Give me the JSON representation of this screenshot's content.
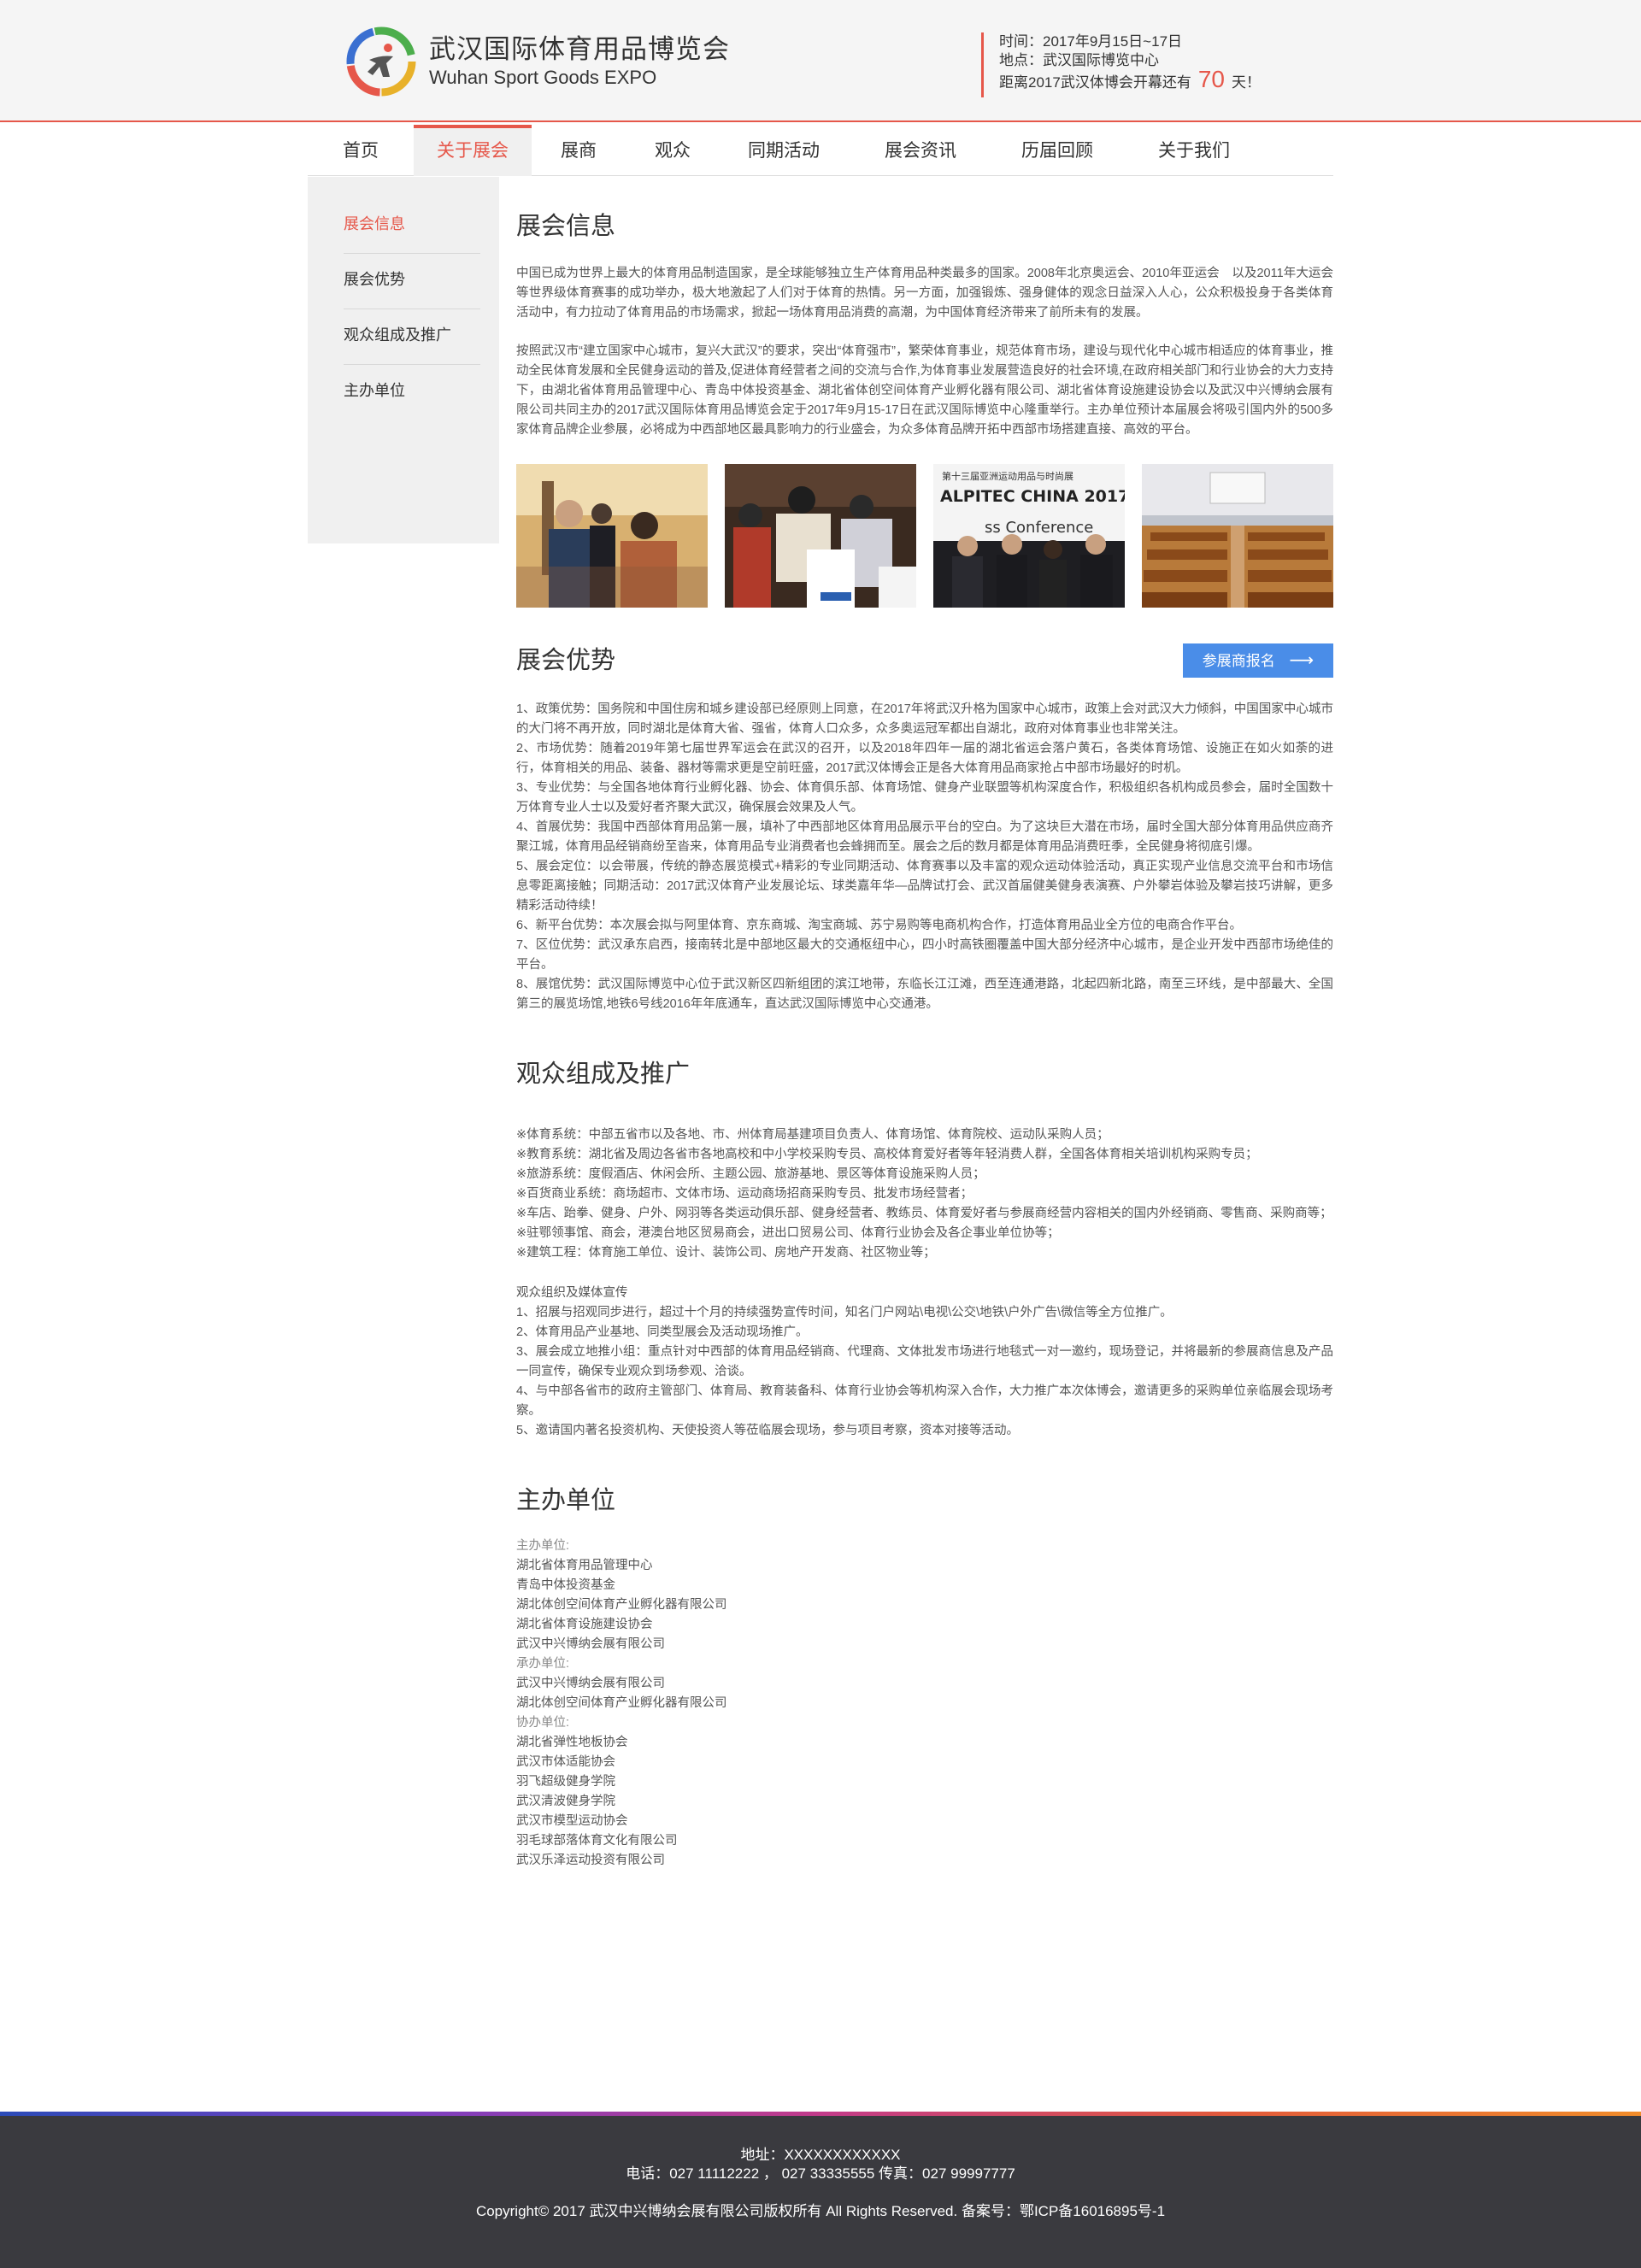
{
  "header": {
    "logo_cn": "武汉国际体育用品博览会",
    "logo_en": "Wuhan Sport Goods EXPO",
    "time_text": "时间：2017年9月15日~17日",
    "place_text": "地点：武汉国际博览中心",
    "countdown_prefix": "距离2017武汉体博会开幕还有",
    "countdown_days": "70",
    "countdown_suffix": "天！"
  },
  "nav": {
    "items": [
      {
        "label": "首页"
      },
      {
        "label": "关于展会"
      },
      {
        "label": "展商"
      },
      {
        "label": "观众"
      },
      {
        "label": "同期活动"
      },
      {
        "label": "展会资讯"
      },
      {
        "label": "历届回顾"
      },
      {
        "label": "关于我们"
      }
    ]
  },
  "sidebar": {
    "items": [
      {
        "label": "展会信息"
      },
      {
        "label": "展会优势"
      },
      {
        "label": "观众组成及推广"
      },
      {
        "label": "主办单位"
      }
    ]
  },
  "info": {
    "title": "展会信息",
    "p1": "中国已成为世界上最大的体育用品制造国家，是全球能够独立生产体育用品种类最多的国家。2008年北京奥运会、2010年亚运会　以及2011年大运会等世界级体育赛事的成功举办，极大地激起了人们对于体育的热情。另一方面，加强锻炼、强身健体的观念日益深入人心，公众积极投身于各类体育活动中，有力拉动了体育用品的市场需求，掀起一场体育用品消费的高潮，为中国体育经济带来了前所未有的发展。",
    "p2": "按照武汉市“建立国家中心城市，复兴大武汉”的要求，突出“体育强市”，繁荣体育事业，规范体育市场，建设与现代化中心城市相适应的体育事业，推动全民体育发展和全民健身运动的普及,促进体育经营者之间的交流与合作,为体育事业发展营造良好的社会环境,在政府相关部门和行业协会的大力支持下，由湖北省体育用品管理中心、青岛中体投资基金、湖北省体创空间体育产业孵化器有限公司、湖北省体育设施建设协会以及武汉中兴博纳会展有限公司共同主办的2017武汉国际体育用品博览会定于2017年9月15-17日在武汉国际博览中心隆重举行。主办单位预计本届展会将吸引国内外的500多家体育品牌企业参展，必将成为中西部地区最具影响力的行业盛会，为众多体育品牌开拓中西部市场搭建直接、高效的平台。",
    "photo3_line1": "第十三届亚洲运动用品与时尚展",
    "photo3_line2": "ALPITEC CHINA 2017",
    "photo3_line3": "ss Conference"
  },
  "advantage": {
    "title": "展会优势",
    "button_label": "参展商报名",
    "lines": [
      "1、政策优势：国务院和中国住房和城乡建设部已经原则上同意，在2017年将武汉升格为国家中心城市，政策上会对武汉大力倾斜，中国国家中心城市的大门将不再开放，同时湖北是体育大省、强省，体育人口众多，众多奥运冠军都出自湖北，政府对体育事业也非常关注。",
      "2、市场优势：随着2019年第七届世界军运会在武汉的召开，以及2018年四年一届的湖北省运会落户黄石，各类体育场馆、设施正在如火如荼的进行，体育相关的用品、装备、器材等需求更是空前旺盛，2017武汉体博会正是各大体育用品商家抢占中部市场最好的时机。",
      "3、专业优势：与全国各地体育行业孵化器、协会、体育俱乐部、体育场馆、健身产业联盟等机构深度合作，积极组织各机构成员参会，届时全国数十万体育专业人士以及爱好者齐聚大武汉，确保展会效果及人气。",
      "4、首展优势：我国中西部体育用品第一展，填补了中西部地区体育用品展示平台的空白。为了这块巨大潜在市场，届时全国大部分体育用品供应商齐聚江城，体育用品经销商纷至沓来，体育用品专业消费者也会蜂拥而至。展会之后的数月都是体育用品消费旺季，全民健身将彻底引爆。",
      "5、展会定位：以会带展，传统的静态展览模式+精彩的专业同期活动、体育赛事以及丰富的观众运动体验活动，真正实现产业信息交流平台和市场信息零距离接触；同期活动：2017武汉体育产业发展论坛、球类嘉年华—品牌试打会、武汉首届健美健身表演赛、户外攀岩体验及攀岩技巧讲解，更多精彩活动待续！",
      "6、新平台优势：本次展会拟与阿里体育、京东商城、淘宝商城、苏宁易购等电商机构合作，打造体育用品业全方位的电商合作平台。",
      "7、区位优势：武汉承东启西，接南转北是中部地区最大的交通枢纽中心，四小时高铁圈覆盖中国大部分经济中心城市，是企业开发中西部市场绝佳的平台。",
      "8、展馆优势：武汉国际博览中心位于武汉新区四新组团的滨江地带，东临长江江滩，西至连通港路，北起四新北路，南至三环线，是中部最大、全国第三的展览场馆,地铁6号线2016年年底通车，直达武汉国际博览中心交通港。"
    ]
  },
  "audience": {
    "title": "观众组成及推广",
    "lines": [
      "※体育系统：中部五省市以及各地、市、州体育局基建项目负责人、体育场馆、体育院校、运动队采购人员；",
      "※教育系统：湖北省及周边各省市各地高校和中小学校采购专员、高校体育爱好者等年轻消费人群，全国各体育相关培训机构采购专员；",
      "※旅游系统：度假酒店、休闲会所、主题公园、旅游基地、景区等体育设施采购人员；",
      "※百货商业系统：商场超市、文体市场、运动商场招商采购专员、批发市场经营者；",
      "※车店、跆拳、健身、户外、网羽等各类运动俱乐部、健身经营者、教练员、体育爱好者与参展商经营内容相关的国内外经销商、零售商、采购商等；",
      "※驻鄂领事馆、商会，港澳台地区贸易商会，进出口贸易公司、体育行业协会及各企事业单位协等；",
      "※建筑工程：体育施工单位、设计、装饰公司、房地产开发商、社区物业等；"
    ],
    "promo_title": "观众组织及媒体宣传",
    "promo_lines": [
      "1、招展与招观同步进行，超过十个月的持续强势宣传时间，知名门户网站\\电视\\公交\\地铁\\户外广告\\微信等全方位推广。",
      "2、体育用品产业基地、同类型展会及活动现场推广。",
      "3、展会成立地推小组：重点针对中西部的体育用品经销商、代理商、文体批发市场进行地毯式一对一邀约，现场登记，并将最新的参展商信息及产品一同宣传，确保专业观众到场参观、洽谈。",
      "4、与中部各省市的政府主管部门、体育局、教育装备科、体育行业协会等机构深入合作，大力推广本次体博会，邀请更多的采购单位亲临展会现场考察。",
      "5、邀请国内著名投资机构、天使投资人等莅临展会现场，参与项目考察，资本对接等活动。"
    ]
  },
  "organizers": {
    "title": "主办单位",
    "host_label": "主办单位:",
    "hosts": [
      "湖北省体育用品管理中心",
      "青岛中体投资基金",
      "湖北体创空间体育产业孵化器有限公司",
      "湖北省体育设施建设协会",
      "武汉中兴博纳会展有限公司"
    ],
    "undertake_label": "承办单位:",
    "undertakers": [
      "武汉中兴博纳会展有限公司",
      "湖北体创空间体育产业孵化器有限公司"
    ],
    "coorg_label": "协办单位:",
    "coorgs": [
      "湖北省弹性地板协会",
      "武汉市体适能协会",
      "羽飞超级健身学院",
      "武汉清波健身学院",
      "武汉市模型运动协会",
      "羽毛球部落体育文化有限公司",
      "武汉乐泽运动投资有限公司"
    ]
  },
  "footer": {
    "address": "地址：XXXXXXXXXXXX",
    "phones": "电话：027 11112222 ，  027 33335555 传真：027 99997777",
    "copyright": "Copyright© 2017 武汉中兴博纳会展有限公司版权所有 All Rights Reserved.  备案号：鄂ICP备16016895号-1"
  },
  "colors": {
    "accent": "#e6574a",
    "button_blue": "#4a8de8",
    "footer_bg": "#3a3a3f",
    "sidebar_bg": "#f0f0f0"
  }
}
